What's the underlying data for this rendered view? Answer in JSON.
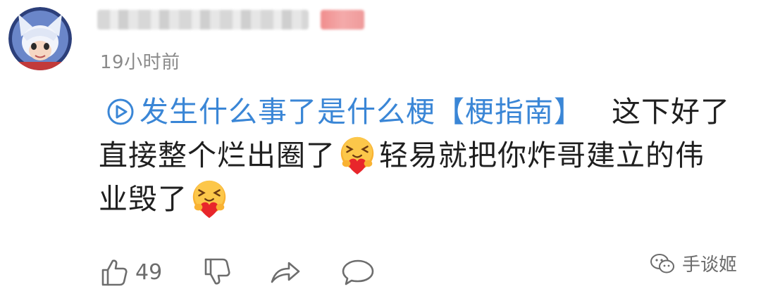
{
  "comment": {
    "author": {
      "avatar_icon": "anime-wolf-avatar-icon",
      "name_blurred": true,
      "badge_blurred": true
    },
    "timestamp": "19小时前",
    "topic_link": {
      "icon": "play-circle-icon",
      "text": "发生什么事了是什么梗【梗指南】"
    },
    "body": {
      "line1_rest": "这下好了",
      "line2_before_emoji": "直接整个烂出圈了",
      "line2_after_emoji": "轻易就把你炸哥建立的伟",
      "line3_before_emoji": "业毁了",
      "emoji_name": "heart-hug-laugh-emoji"
    },
    "actions": {
      "like_icon": "thumbs-up-icon",
      "like_count": "49",
      "dislike_icon": "thumbs-down-icon",
      "share_icon": "share-arrow-icon",
      "comment_icon": "speech-bubble-icon"
    }
  },
  "watermark": {
    "icon": "wechat-icon",
    "text": "手谈姬"
  },
  "colors": {
    "link_blue": "#3a86d6",
    "text": "#1f1f1f",
    "meta_gray": "#8a8a8a"
  }
}
